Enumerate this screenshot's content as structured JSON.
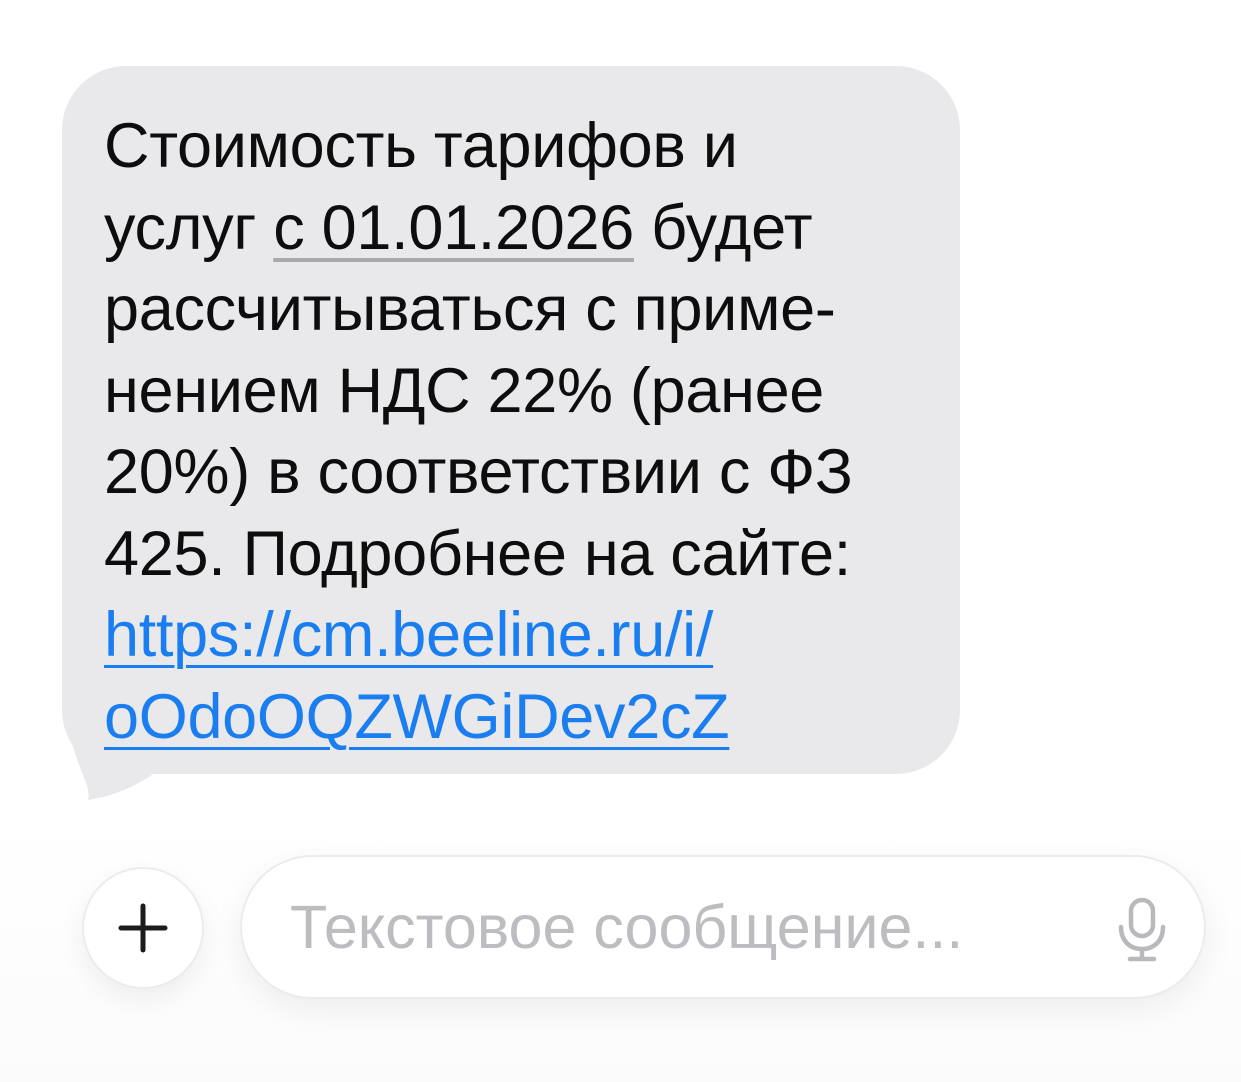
{
  "message": {
    "lines": {
      "l1": "Стоимость тарифов и",
      "l2_pre": "услуг ",
      "l2_date": "с 01.01.2026",
      "l2_post": " будет",
      "l3": "рассчитываться с приме-",
      "l4": "нением НДС 22% (ранее",
      "l5": "20%) в соответствии с ФЗ",
      "l6": "425. Подробнее на сайте:",
      "link_part1": "https://cm.beeline.ru/i/",
      "link_part2": "oOdoOQZWGiDev2cZ"
    }
  },
  "composer": {
    "add_icon": "plus-icon",
    "placeholder": "Текстовое сообщение...",
    "value": "",
    "mic_icon": "microphone-icon"
  },
  "colors": {
    "bubble": "#e9e9eb",
    "link": "#1a7ef0",
    "placeholder": "#bdbdc1"
  }
}
